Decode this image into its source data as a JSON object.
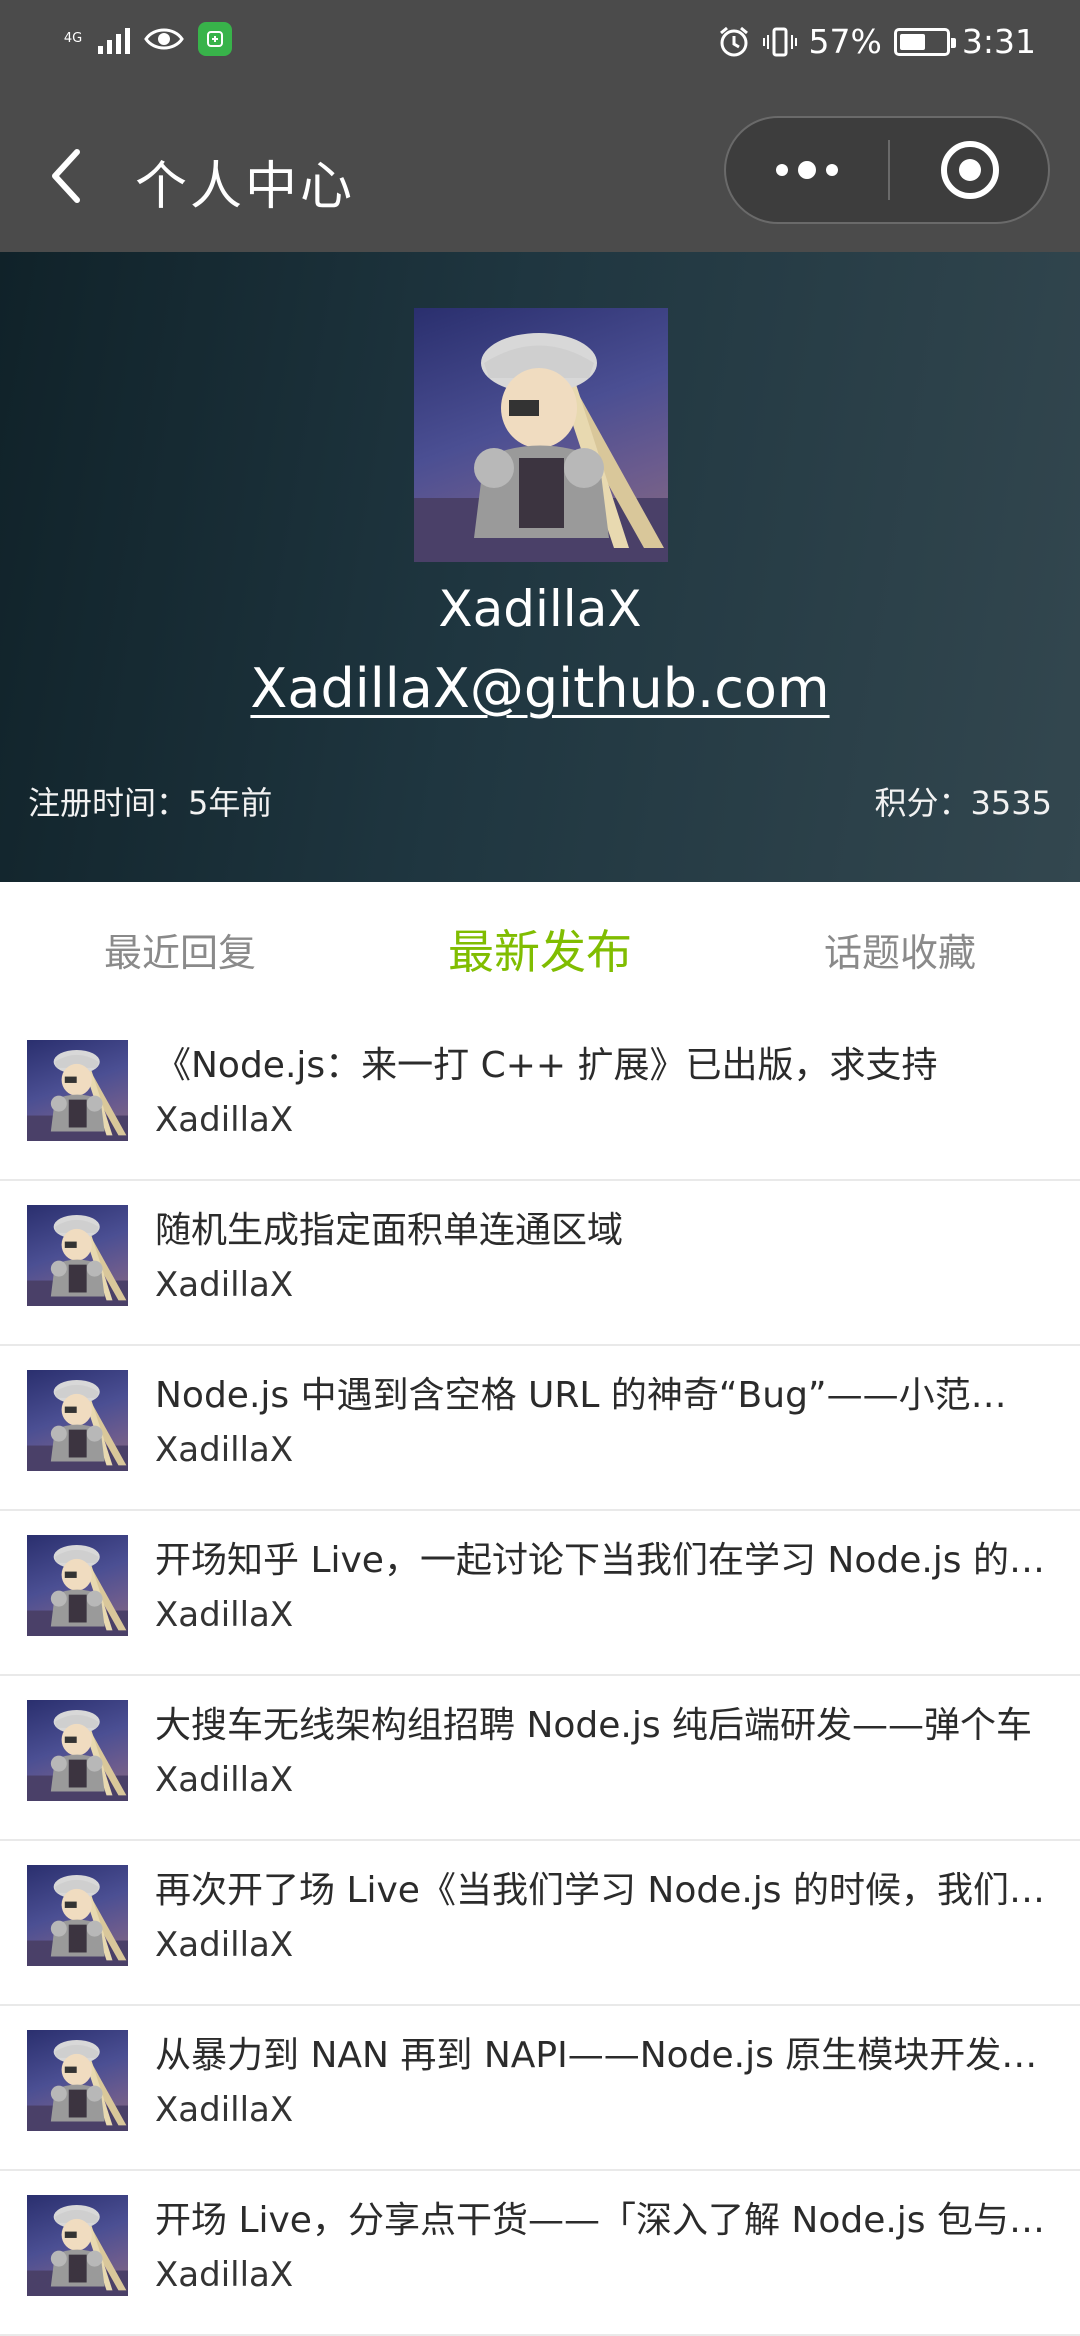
{
  "status_bar": {
    "network": "4G",
    "battery": "57%",
    "battery_level": 0.57,
    "time": "3:31",
    "icons": [
      "signal-icon",
      "eye-icon",
      "app-badge-icon",
      "alarm-icon",
      "vibrate-icon",
      "battery-icon"
    ]
  },
  "header": {
    "title": "个人中心",
    "back_icon": "chevron-left-icon",
    "more_icon": "more-dots-icon",
    "close_icon": "target-close-icon"
  },
  "profile": {
    "username": "XadillaX",
    "github": "XadillaX@github.com",
    "register_time": "注册时间：5年前",
    "score": "积分：3535"
  },
  "tabs": [
    {
      "label": "最近回复",
      "active": false
    },
    {
      "label": "最新发布",
      "active": true
    },
    {
      "label": "话题收藏",
      "active": false
    }
  ],
  "colors": {
    "accent": "#80bd01",
    "topbar": "#4b4b4b"
  },
  "topics": [
    {
      "title": "《Node.js：来一打 C++ 扩展》已出版，求支持",
      "author": "XadillaX"
    },
    {
      "title": "随机生成指定面积单连通区域",
      "author": "XadillaX"
    },
    {
      "title": "Node.js 中遇到含空格 URL 的神奇“Bug”——小范…",
      "author": "XadillaX"
    },
    {
      "title": "开场知乎 Live，一起讨论下当我们在学习 Node.js 的…",
      "author": "XadillaX"
    },
    {
      "title": "大搜车无线架构组招聘 Node.js 纯后端研发——弹个车",
      "author": "XadillaX"
    },
    {
      "title": "再次开了场 Live《当我们学习 Node.js 的时候，我们…",
      "author": "XadillaX"
    },
    {
      "title": "从暴力到 NAN 再到 NAPI——Node.js 原生模块开发…",
      "author": "XadillaX"
    },
    {
      "title": "开场 Live，分享点干货——「深入了解 Node.js 包与…",
      "author": "XadillaX"
    }
  ]
}
